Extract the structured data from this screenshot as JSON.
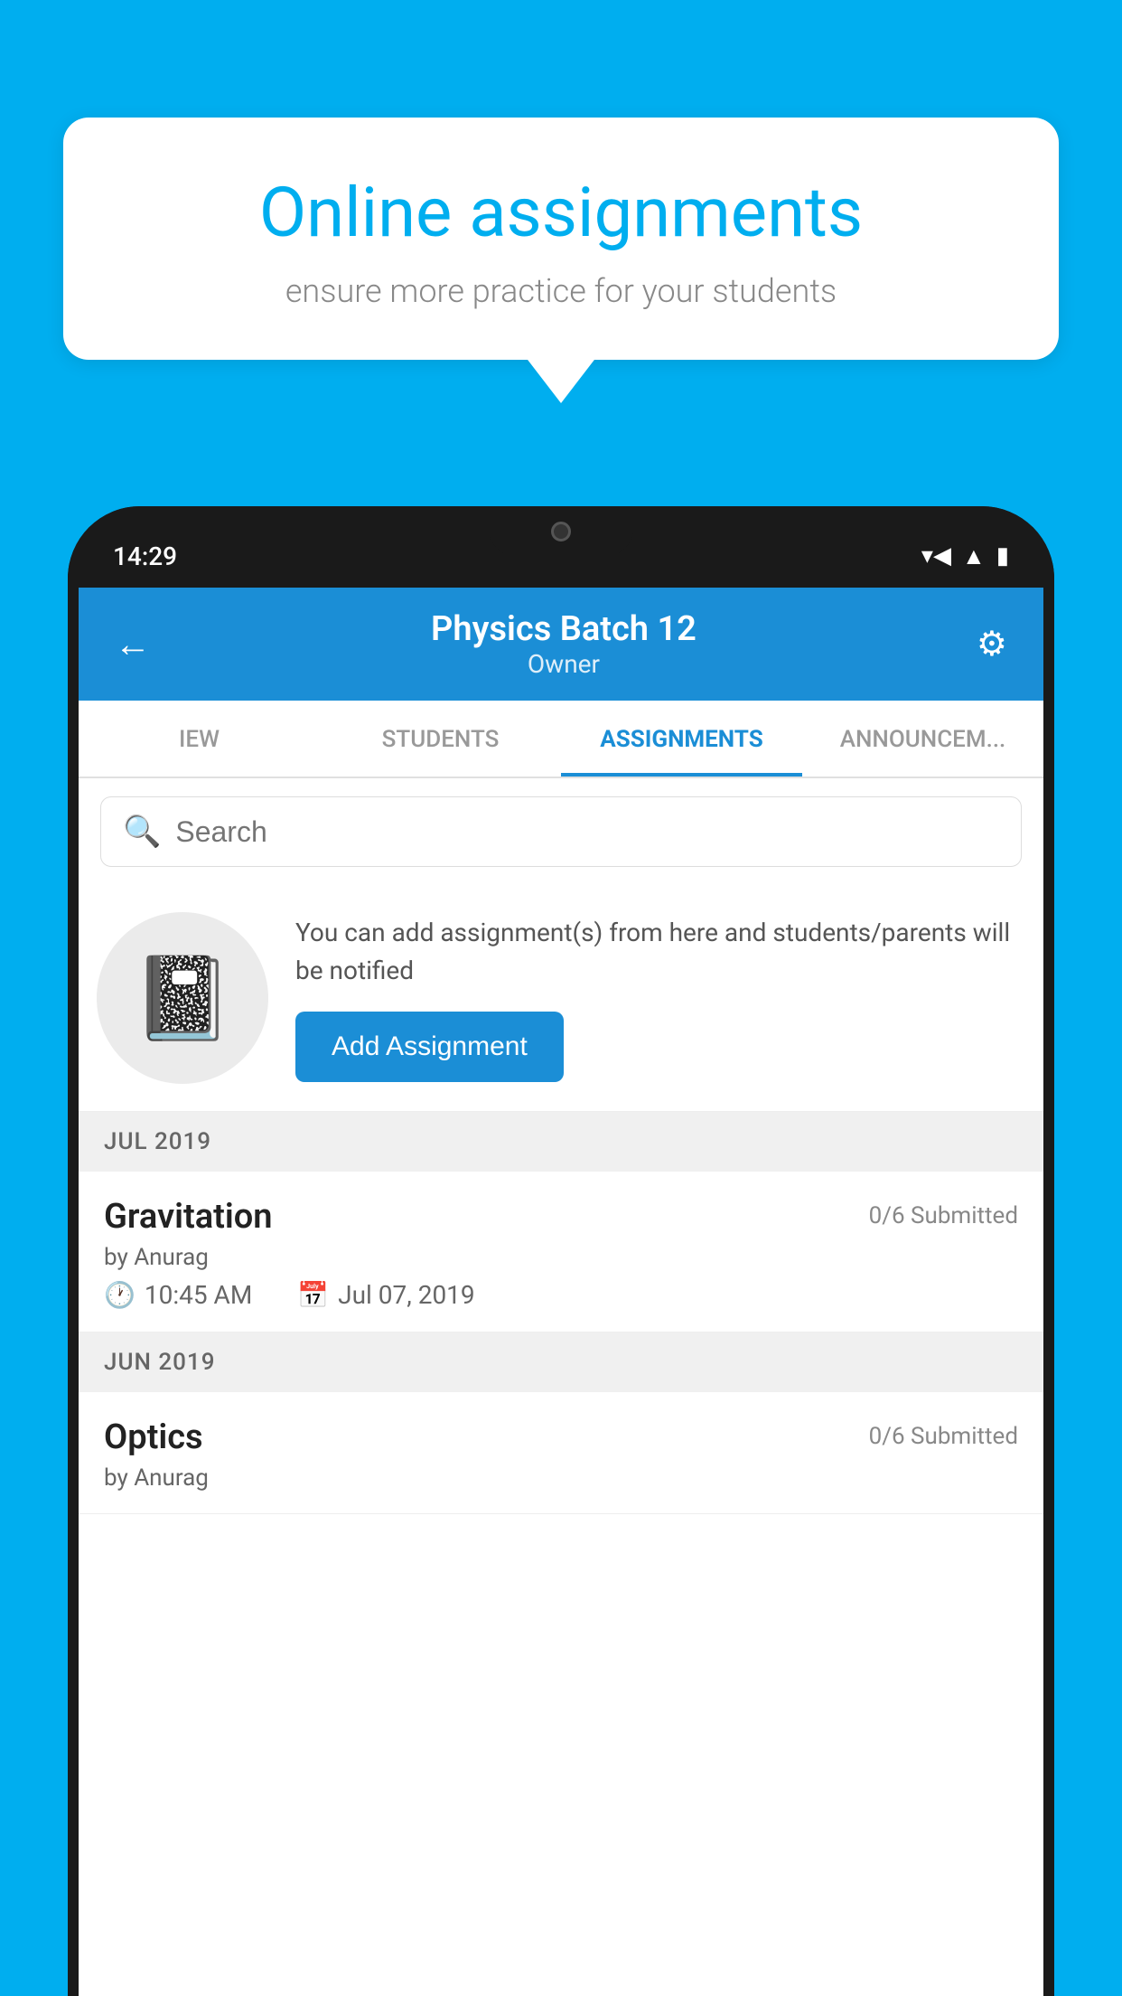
{
  "background_color": "#00AEEF",
  "speech_bubble": {
    "title": "Online assignments",
    "subtitle": "ensure more practice for your students"
  },
  "status_bar": {
    "time": "14:29",
    "wifi": "▼",
    "signal": "▲",
    "battery": "▮"
  },
  "app_header": {
    "title": "Physics Batch 12",
    "subtitle": "Owner",
    "back_icon": "←",
    "settings_icon": "⚙"
  },
  "tabs": [
    {
      "label": "IEW",
      "active": false
    },
    {
      "label": "STUDENTS",
      "active": false
    },
    {
      "label": "ASSIGNMENTS",
      "active": true
    },
    {
      "label": "ANNOUNCEM...",
      "active": false
    }
  ],
  "search": {
    "placeholder": "Search",
    "icon": "🔍"
  },
  "promo": {
    "text": "You can add assignment(s) from here and students/parents will be notified",
    "button_label": "Add Assignment"
  },
  "sections": [
    {
      "header": "JUL 2019",
      "assignments": [
        {
          "name": "Gravitation",
          "submitted": "0/6 Submitted",
          "author": "by Anurag",
          "time": "10:45 AM",
          "date": "Jul 07, 2019"
        }
      ]
    },
    {
      "header": "JUN 2019",
      "assignments": [
        {
          "name": "Optics",
          "submitted": "0/6 Submitted",
          "author": "by Anurag",
          "time": "",
          "date": ""
        }
      ]
    }
  ]
}
